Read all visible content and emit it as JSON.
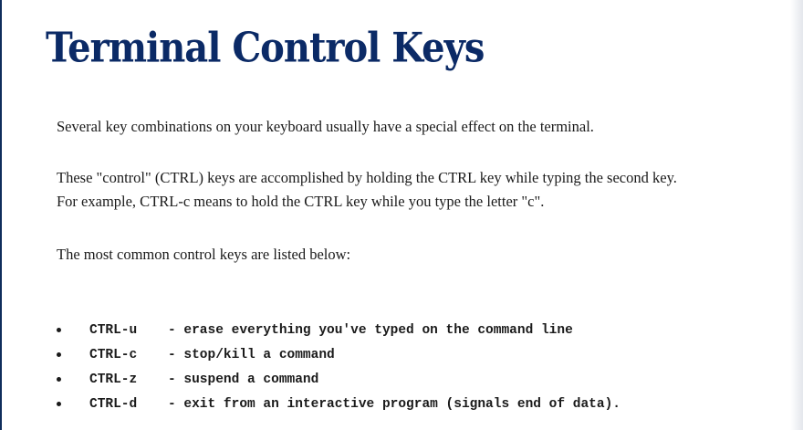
{
  "title": "Terminal Control Keys",
  "paragraphs": {
    "intro": "Several key combinations on your keyboard usually have a special effect on the terminal.",
    "explain_line1": "These \"control\" (CTRL) keys are accomplished by holding the CTRL key while typing the second key.",
    "explain_line2": "For example, CTRL-c means to hold the CTRL key while you type the letter \"c\".",
    "list_intro": "The most common control keys are listed below:"
  },
  "keys": [
    {
      "key": "CTRL-u",
      "description": "- erase everything you've typed on the command line"
    },
    {
      "key": "CTRL-c",
      "description": "- stop/kill a command"
    },
    {
      "key": "CTRL-z",
      "description": "- suspend a command"
    },
    {
      "key": "CTRL-d",
      "description": "- exit from an interactive program (signals end of data)."
    }
  ],
  "colors": {
    "title": "#0b2a66",
    "text": "#1a1a1a",
    "left_rule": "#0f2d5c"
  }
}
